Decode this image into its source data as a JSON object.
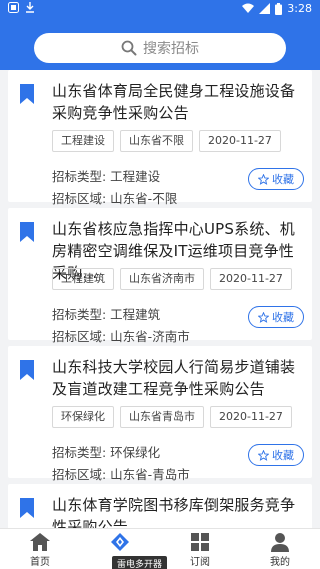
{
  "status_bar": {
    "time": "3:28"
  },
  "search": {
    "placeholder": "搜索招标"
  },
  "colors": {
    "primary": "#2f73e8",
    "background": "#f2f3f5"
  },
  "cards": [
    {
      "title": "山东省体育局全民健身工程设施设备采购竞争性采购公告",
      "tags": [
        "工程建设",
        "山东省不限",
        "2020-11-27"
      ],
      "type_label": "招标类型: 工程建设",
      "region_label": "招标区域: 山东省-不限",
      "fav_label": "收藏"
    },
    {
      "title": "山东省核应急指挥中心UPS系统、机房精密空调维保及IT运维项目竞争性采购...",
      "tags": [
        "工程建筑",
        "山东省济南市",
        "2020-11-27"
      ],
      "type_label": "招标类型: 工程建筑",
      "region_label": "招标区域: 山东省-济南市",
      "fav_label": "收藏"
    },
    {
      "title": "山东科技大学校园人行简易步道铺装及盲道改建工程竞争性采购公告",
      "tags": [
        "环保绿化",
        "山东省青岛市",
        "2020-11-27"
      ],
      "type_label": "招标类型: 环保绿化",
      "region_label": "招标区域: 山东省-青岛市",
      "fav_label": "收藏"
    },
    {
      "title": "山东体育学院图书移库倒架服务竞争性采购公告"
    }
  ],
  "tabs": [
    {
      "label": "首页",
      "icon": "home-icon"
    },
    {
      "label": "",
      "icon": "diamond-icon"
    },
    {
      "label": "订阅",
      "icon": "grid-icon"
    },
    {
      "label": "我的",
      "icon": "user-icon"
    }
  ],
  "tooltip": "雷电多开器"
}
